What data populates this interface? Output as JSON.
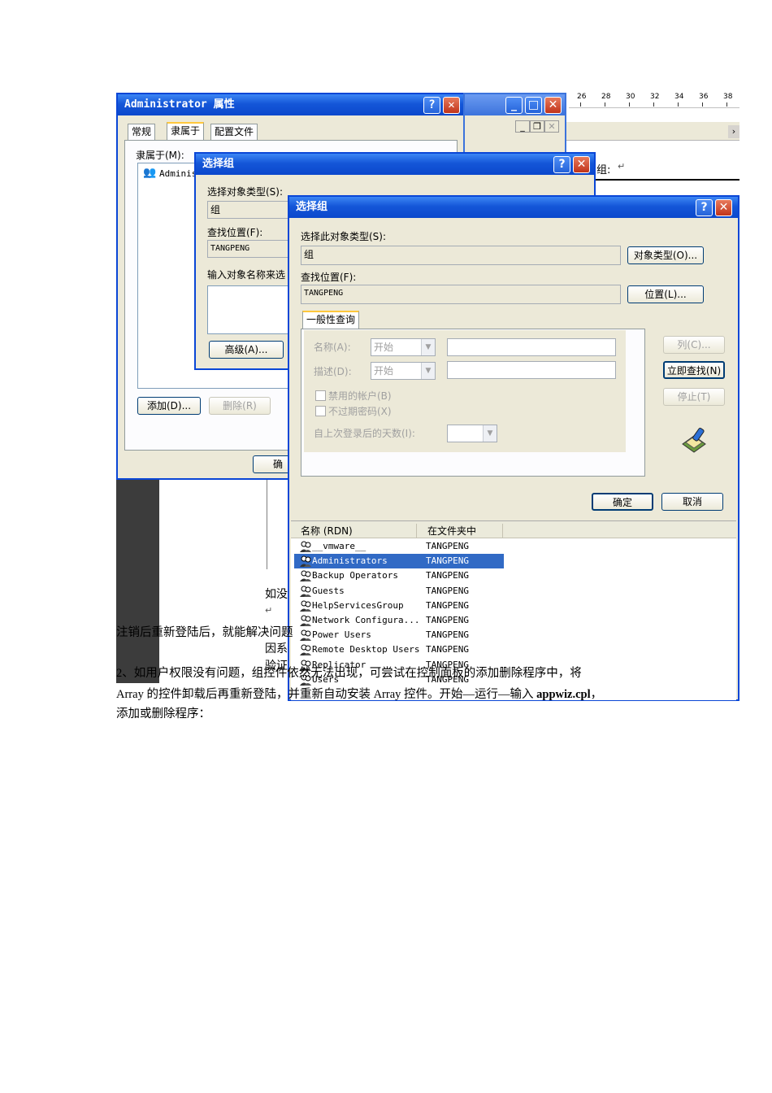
{
  "ruler": {
    "ticks": [
      "26",
      "28",
      "30",
      "32",
      "34",
      "36",
      "38"
    ]
  },
  "back_window": {
    "title": "Administrator 属性",
    "tabs": [
      "常规",
      "隶属于",
      "配置文件"
    ],
    "member_of_label": "隶属于(M):",
    "member_item": "Adminis",
    "add_button": "添加(D)...",
    "remove_button": "删除(R)",
    "ok_partial": "确"
  },
  "mid_window": {
    "title": "选择组",
    "object_type_label": "选择对象类型(S):",
    "object_type_value": "组",
    "location_label": "查找位置(F):",
    "location_value": "TANGPENG",
    "enter_names_label": "输入对象名称来选",
    "advanced_button": "高级(A)..."
  },
  "doc_fragment": {
    "group_label": "组:"
  },
  "front_window": {
    "title": "选择组",
    "object_type_label": "选择此对象类型(S):",
    "object_type_value": "组",
    "object_types_button": "对象类型(O)...",
    "location_label": "查找位置(F):",
    "location_value": "TANGPENG",
    "locations_button": "位置(L)...",
    "query_tab": "一般性查询",
    "name_label": "名称(A):",
    "name_mode": "开始",
    "desc_label": "描述(D):",
    "desc_mode": "开始",
    "disabled_accounts": "禁用的帐户(B)",
    "non_expiring": "不过期密码(X)",
    "days_since_logon": "自上次登录后的天数(I):",
    "columns_button": "列(C)...",
    "find_now_button": "立即查找(N)",
    "stop_button": "停止(T)",
    "ok_button": "确定",
    "cancel_button": "取消",
    "results": {
      "headers": [
        "名称 (RDN)",
        "在文件夹中"
      ],
      "rows": [
        {
          "name": "__vmware__",
          "folder": "TANGPENG"
        },
        {
          "name": "Administrators",
          "folder": "TANGPENG",
          "selected": true
        },
        {
          "name": "Backup Operators",
          "folder": "TANGPENG"
        },
        {
          "name": "Guests",
          "folder": "TANGPENG"
        },
        {
          "name": "HelpServicesGroup",
          "folder": "TANGPENG"
        },
        {
          "name": "Network Configura...",
          "folder": "TANGPENG"
        },
        {
          "name": "Power Users",
          "folder": "TANGPENG"
        },
        {
          "name": "Remote Desktop Users",
          "folder": "TANGPENG"
        },
        {
          "name": "Replicator",
          "folder": "TANGPENG"
        },
        {
          "name": "Users",
          "folder": "TANGPENG"
        }
      ]
    }
  },
  "doc": {
    "frag1": "如没",
    "frag2": "因系",
    "frag3": "验证",
    "para1": "注销后重新登陆后，就能解决问题",
    "para2_line1": "2、如用户权限没有问题，组控件依然无法出现，可尝试在控制面板的添加删除程序中，将",
    "para2_line2_a": "Array 的控件卸载后再重新登陆，并重新自动安装 Array 控件。开始—运行—输入 ",
    "para2_line2_b": "appwiz.cpl",
    "para2_line2_c": "，",
    "para3": "添加或删除程序："
  },
  "colors": {
    "titlebar": "#0b48cc",
    "selection": "#316ac5",
    "dialog_bg": "#ece9d8"
  }
}
